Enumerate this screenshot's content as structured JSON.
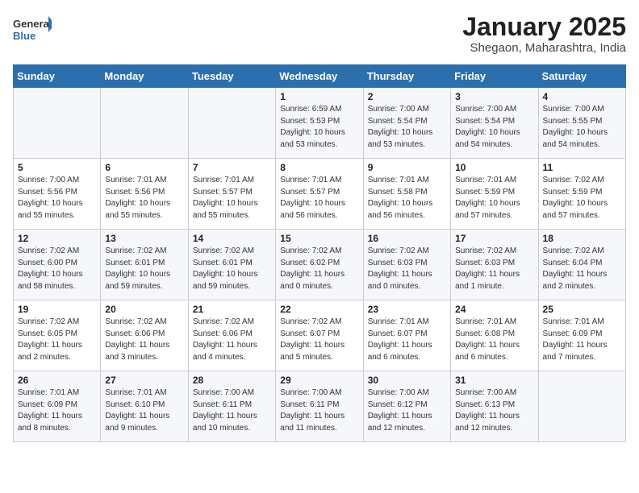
{
  "logo": {
    "general": "General",
    "blue": "Blue"
  },
  "title": "January 2025",
  "location": "Shegaon, Maharashtra, India",
  "days_of_week": [
    "Sunday",
    "Monday",
    "Tuesday",
    "Wednesday",
    "Thursday",
    "Friday",
    "Saturday"
  ],
  "weeks": [
    [
      {
        "day": "",
        "info": ""
      },
      {
        "day": "",
        "info": ""
      },
      {
        "day": "",
        "info": ""
      },
      {
        "day": "1",
        "info": "Sunrise: 6:59 AM\nSunset: 5:53 PM\nDaylight: 10 hours\nand 53 minutes."
      },
      {
        "day": "2",
        "info": "Sunrise: 7:00 AM\nSunset: 5:54 PM\nDaylight: 10 hours\nand 53 minutes."
      },
      {
        "day": "3",
        "info": "Sunrise: 7:00 AM\nSunset: 5:54 PM\nDaylight: 10 hours\nand 54 minutes."
      },
      {
        "day": "4",
        "info": "Sunrise: 7:00 AM\nSunset: 5:55 PM\nDaylight: 10 hours\nand 54 minutes."
      }
    ],
    [
      {
        "day": "5",
        "info": "Sunrise: 7:00 AM\nSunset: 5:56 PM\nDaylight: 10 hours\nand 55 minutes."
      },
      {
        "day": "6",
        "info": "Sunrise: 7:01 AM\nSunset: 5:56 PM\nDaylight: 10 hours\nand 55 minutes."
      },
      {
        "day": "7",
        "info": "Sunrise: 7:01 AM\nSunset: 5:57 PM\nDaylight: 10 hours\nand 55 minutes."
      },
      {
        "day": "8",
        "info": "Sunrise: 7:01 AM\nSunset: 5:57 PM\nDaylight: 10 hours\nand 56 minutes."
      },
      {
        "day": "9",
        "info": "Sunrise: 7:01 AM\nSunset: 5:58 PM\nDaylight: 10 hours\nand 56 minutes."
      },
      {
        "day": "10",
        "info": "Sunrise: 7:01 AM\nSunset: 5:59 PM\nDaylight: 10 hours\nand 57 minutes."
      },
      {
        "day": "11",
        "info": "Sunrise: 7:02 AM\nSunset: 5:59 PM\nDaylight: 10 hours\nand 57 minutes."
      }
    ],
    [
      {
        "day": "12",
        "info": "Sunrise: 7:02 AM\nSunset: 6:00 PM\nDaylight: 10 hours\nand 58 minutes."
      },
      {
        "day": "13",
        "info": "Sunrise: 7:02 AM\nSunset: 6:01 PM\nDaylight: 10 hours\nand 59 minutes."
      },
      {
        "day": "14",
        "info": "Sunrise: 7:02 AM\nSunset: 6:01 PM\nDaylight: 10 hours\nand 59 minutes."
      },
      {
        "day": "15",
        "info": "Sunrise: 7:02 AM\nSunset: 6:02 PM\nDaylight: 11 hours\nand 0 minutes."
      },
      {
        "day": "16",
        "info": "Sunrise: 7:02 AM\nSunset: 6:03 PM\nDaylight: 11 hours\nand 0 minutes."
      },
      {
        "day": "17",
        "info": "Sunrise: 7:02 AM\nSunset: 6:03 PM\nDaylight: 11 hours\nand 1 minute."
      },
      {
        "day": "18",
        "info": "Sunrise: 7:02 AM\nSunset: 6:04 PM\nDaylight: 11 hours\nand 2 minutes."
      }
    ],
    [
      {
        "day": "19",
        "info": "Sunrise: 7:02 AM\nSunset: 6:05 PM\nDaylight: 11 hours\nand 2 minutes."
      },
      {
        "day": "20",
        "info": "Sunrise: 7:02 AM\nSunset: 6:06 PM\nDaylight: 11 hours\nand 3 minutes."
      },
      {
        "day": "21",
        "info": "Sunrise: 7:02 AM\nSunset: 6:06 PM\nDaylight: 11 hours\nand 4 minutes."
      },
      {
        "day": "22",
        "info": "Sunrise: 7:02 AM\nSunset: 6:07 PM\nDaylight: 11 hours\nand 5 minutes."
      },
      {
        "day": "23",
        "info": "Sunrise: 7:01 AM\nSunset: 6:07 PM\nDaylight: 11 hours\nand 6 minutes."
      },
      {
        "day": "24",
        "info": "Sunrise: 7:01 AM\nSunset: 6:08 PM\nDaylight: 11 hours\nand 6 minutes."
      },
      {
        "day": "25",
        "info": "Sunrise: 7:01 AM\nSunset: 6:09 PM\nDaylight: 11 hours\nand 7 minutes."
      }
    ],
    [
      {
        "day": "26",
        "info": "Sunrise: 7:01 AM\nSunset: 6:09 PM\nDaylight: 11 hours\nand 8 minutes."
      },
      {
        "day": "27",
        "info": "Sunrise: 7:01 AM\nSunset: 6:10 PM\nDaylight: 11 hours\nand 9 minutes."
      },
      {
        "day": "28",
        "info": "Sunrise: 7:00 AM\nSunset: 6:11 PM\nDaylight: 11 hours\nand 10 minutes."
      },
      {
        "day": "29",
        "info": "Sunrise: 7:00 AM\nSunset: 6:11 PM\nDaylight: 11 hours\nand 11 minutes."
      },
      {
        "day": "30",
        "info": "Sunrise: 7:00 AM\nSunset: 6:12 PM\nDaylight: 11 hours\nand 12 minutes."
      },
      {
        "day": "31",
        "info": "Sunrise: 7:00 AM\nSunset: 6:13 PM\nDaylight: 11 hours\nand 12 minutes."
      },
      {
        "day": "",
        "info": ""
      }
    ]
  ]
}
